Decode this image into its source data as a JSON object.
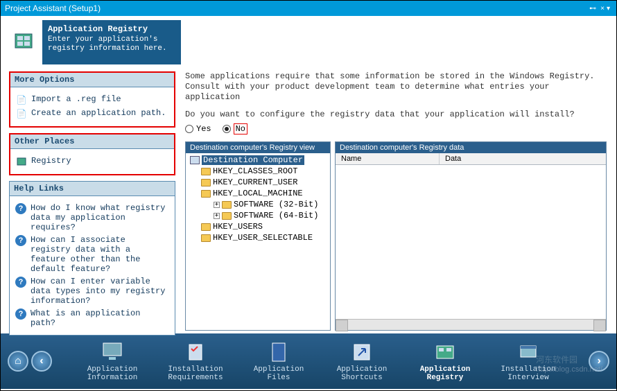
{
  "titlebar": {
    "title": "Project Assistant (Setup1)",
    "pin": "⊷",
    "close": "×",
    "menu": "▾"
  },
  "header": {
    "heading": "Application Registry",
    "sub": "Enter your application's registry information here."
  },
  "panels": {
    "more_title": "More Options",
    "more_items": [
      "Import a .reg file",
      "Create an application path."
    ],
    "other_title": "Other Places",
    "other_items": [
      "Registry"
    ],
    "help_title": "Help Links",
    "help_items": [
      "How do I know what registry data my application requires?",
      "How can I associate registry data with a feature other than the default feature?",
      "How can I enter variable data types into my registry information?",
      "What is an application path?"
    ]
  },
  "intro": {
    "line1": "Some applications require that some information be stored in the Windows Registry.",
    "line2": "Consult with your product development team to determine what entries your application",
    "question": "Do you want to configure the registry data that your application will install?",
    "yes": "Yes",
    "no": "No"
  },
  "tree": {
    "head": "Destination computer's Registry view",
    "root": "Destination Computer",
    "nodes": [
      "HKEY_CLASSES_ROOT",
      "HKEY_CURRENT_USER",
      "HKEY_LOCAL_MACHINE",
      "SOFTWARE (32-Bit)",
      "SOFTWARE (64-Bit)",
      "HKEY_USERS",
      "HKEY_USER_SELECTABLE"
    ]
  },
  "data_pane": {
    "head": "Destination computer's Registry data",
    "col1": "Name",
    "col2": "Data"
  },
  "steps": [
    "Application\nInformation",
    "Installation\nRequirements",
    "Application\nFiles",
    "Application\nShortcuts",
    "Application\nRegistry",
    "Installation\nInterview"
  ],
  "watermark": {
    "top": "河东软件园",
    "url": "http://blog.csdn.net/"
  }
}
